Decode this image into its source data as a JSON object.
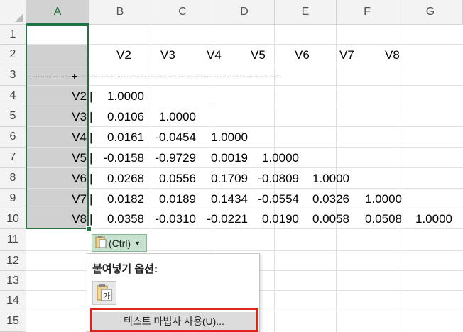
{
  "columns": [
    "A",
    "B",
    "C",
    "D",
    "E",
    "F",
    "G"
  ],
  "selected_column": "A",
  "rows": [
    "1",
    "2",
    "3",
    "4",
    "5",
    "6",
    "7",
    "8",
    "9",
    "10",
    "11",
    "12",
    "13",
    "14",
    "15"
  ],
  "header_row": {
    "bar": "|",
    "labels": [
      "V2",
      "V3",
      "V4",
      "V5",
      "V6",
      "V7",
      "V8"
    ]
  },
  "separator_row": "-------------+-------------------------------------------------------------",
  "matrix": [
    {
      "label": "V2",
      "values": [
        "1.0000"
      ]
    },
    {
      "label": "V3",
      "values": [
        "0.0106",
        "1.0000"
      ]
    },
    {
      "label": "V4",
      "values": [
        "0.0161",
        "-0.0454",
        "1.0000"
      ]
    },
    {
      "label": "V5",
      "values": [
        "-0.0158",
        "-0.9729",
        "0.0019",
        "1.0000"
      ]
    },
    {
      "label": "V6",
      "values": [
        "0.0268",
        "0.0556",
        "0.1709",
        "-0.0809",
        "1.0000"
      ]
    },
    {
      "label": "V7",
      "values": [
        "0.0182",
        "0.0189",
        "0.1434",
        "-0.0554",
        "0.0326",
        "1.0000"
      ]
    },
    {
      "label": "V8",
      "values": [
        "0.0358",
        "-0.0310",
        "-0.0221",
        "0.0190",
        "0.0058",
        "0.0508",
        "1.0000"
      ]
    }
  ],
  "paste_button": {
    "label": "(Ctrl)",
    "icon": "clipboard-icon"
  },
  "paste_menu": {
    "title": "붙여넣기 옵션:",
    "option_icon": "paste-text-icon",
    "option_icon_glyph": "가",
    "item": "텍스트 마법사 사용(U)..."
  },
  "colors": {
    "selection": "#217346",
    "highlight": "#e0231b"
  }
}
